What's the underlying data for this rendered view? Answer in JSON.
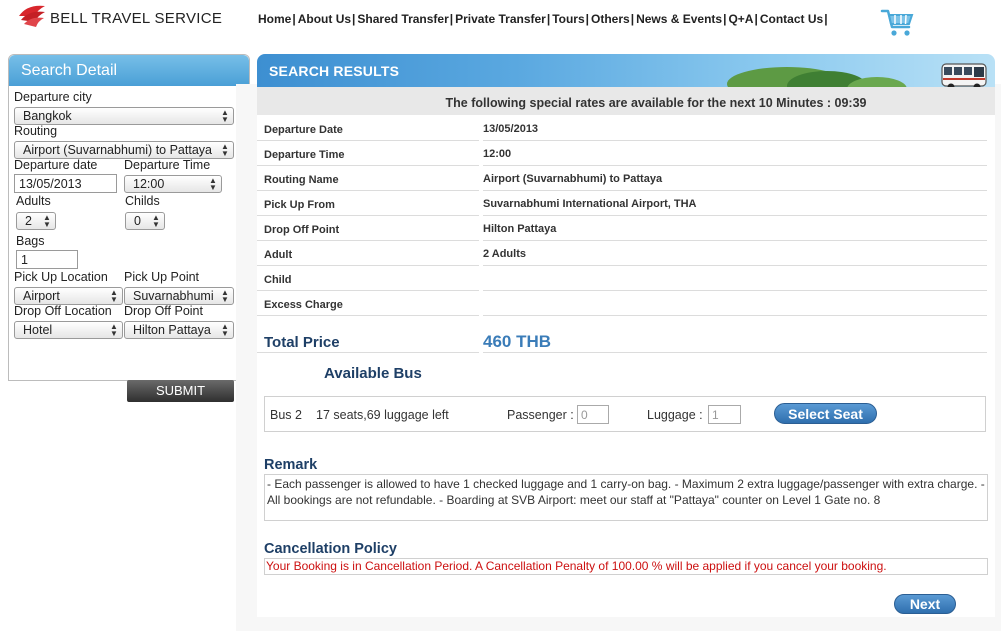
{
  "brand": {
    "name": "BELL TRAVEL SERVICE",
    "logo_color": "#d8262c"
  },
  "nav": {
    "items": [
      "Home",
      "About Us",
      "Shared Transfer",
      "Private Transfer",
      "Tours",
      "Others",
      "News & Events",
      "Q+A",
      "Contact Us"
    ],
    "separator": "|",
    "cart_icon": "shopping-cart-icon"
  },
  "sidebar": {
    "title": "Search Detail",
    "departure_city": {
      "label": "Departure city",
      "value": "Bangkok"
    },
    "routing": {
      "label": "Routing",
      "value": "Airport (Suvarnabhumi) to Pattaya"
    },
    "departure_date": {
      "label": "Departure date",
      "value": "13/05/2013"
    },
    "departure_time": {
      "label": "Departure Time",
      "value": "12:00"
    },
    "adults": {
      "label": "Adults",
      "value": "2"
    },
    "childs": {
      "label": "Childs",
      "value": "0"
    },
    "bags": {
      "label": "Bags",
      "value": "1"
    },
    "pickup_location": {
      "label": "Pick Up Location",
      "value": "Airport"
    },
    "pickup_point": {
      "label": "Pick Up Point",
      "value": "Suvarnabhumi"
    },
    "dropoff_location": {
      "label": "Drop Off Location",
      "value": "Hotel"
    },
    "dropoff_point": {
      "label": "Drop Off Point",
      "value": "Hilton Pattaya"
    },
    "submit_label": "SUBMIT"
  },
  "results": {
    "title": "SEARCH RESULTS",
    "rates_notice": "The following special rates are available for the next 10 Minutes : 09:39",
    "details": [
      {
        "label": "Departure Date",
        "value": "13/05/2013"
      },
      {
        "label": "Departure Time",
        "value": "12:00"
      },
      {
        "label": "Routing Name",
        "value": "Airport (Suvarnabhumi) to Pattaya"
      },
      {
        "label": "Pick Up From",
        "value": "Suvarnabhumi International Airport, THA"
      },
      {
        "label": "Drop Off Point",
        "value": "Hilton Pattaya"
      },
      {
        "label": "Adult",
        "value": "2 Adults"
      },
      {
        "label": "Child",
        "value": ""
      },
      {
        "label": "Excess Charge",
        "value": ""
      }
    ],
    "total": {
      "label": "Total Price",
      "value": "460 THB"
    },
    "available_bus": {
      "title": "Available Bus",
      "bus_name": "Bus 2",
      "seats_info": "17 seats,69 luggage left",
      "passenger_label": "Passenger :",
      "passenger_value": "0",
      "luggage_label": "Luggage :",
      "luggage_value": "1",
      "select_seat_label": "Select Seat"
    },
    "remark": {
      "title": "Remark",
      "text": "- Each passenger is allowed to have 1 checked luggage and 1 carry-on bag. - Maximum 2 extra luggage/passenger with extra charge. - All bookings are not refundable. - Boarding at SVB Airport: meet our staff at \"Pattaya\" counter on Level 1 Gate no. 8"
    },
    "cancellation": {
      "title": "Cancellation Policy",
      "text": "Your Booking is in Cancellation Period. A Cancellation Penalty of 100.00 % will be applied if you cancel your booking.",
      "color": "#cc1010"
    },
    "next_label": "Next"
  },
  "colors": {
    "accent": "#4a9fd6",
    "heading": "#1e3f66",
    "price": "#3a7cb8"
  }
}
